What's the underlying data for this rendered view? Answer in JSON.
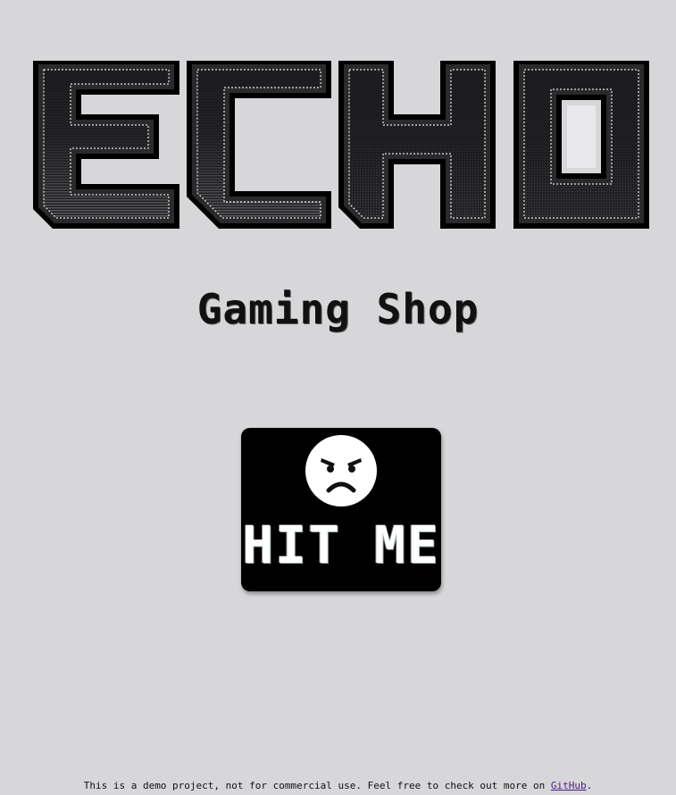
{
  "logo": {
    "text": "ECHO",
    "letters": [
      "E",
      "C",
      "H",
      "O"
    ],
    "fill_color": "#1f1f21",
    "edge_color": "#000000",
    "highlight_color": "#ffffff"
  },
  "subtitle": "Gaming Shop",
  "hit_button": {
    "label": "HIT ME",
    "face_icon": "angry-face-icon",
    "background": "#000000"
  },
  "footer": {
    "text_before": "This is a demo project, not for commercial use. Feel free to check out more on ",
    "link_text": "GitHub",
    "text_after": "."
  },
  "colors": {
    "page_background": "#d7d6d9",
    "link": "#4b1a8a"
  }
}
